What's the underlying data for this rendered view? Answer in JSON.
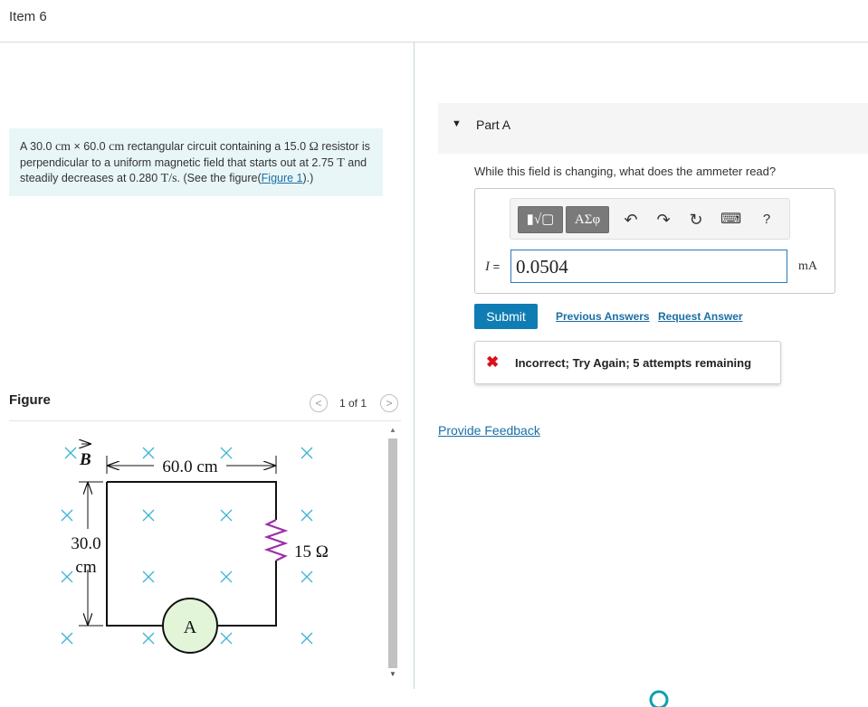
{
  "item_title": "Item 6",
  "problem": {
    "t1": "A 30.0 ",
    "m1": "cm",
    "t2": " × 60.0 ",
    "m2": "cm",
    "t3": " rectangular circuit containing a 15.0 ",
    "m3": "Ω",
    "t4": " resistor is perpendicular to a uniform magnetic field that starts out at 2.75 ",
    "m4": "T",
    "t5": " and steadily decreases at 0.280 ",
    "m5": "T/s",
    "t6": ". (See the figure(",
    "link": "Figure 1",
    "t7": ").)"
  },
  "figure": {
    "label": "Figure",
    "counter": "1 of 1",
    "prev_glyph": "<",
    "next_glyph": ">",
    "labels": {
      "b_field": "B",
      "width": "60.0 cm",
      "height_value": "30.0",
      "height_unit": "cm",
      "resistance": "15 Ω",
      "ammeter": "A"
    }
  },
  "part": {
    "label": "Part A",
    "question": "While this field is changing, what does the ammeter read?"
  },
  "toolbar": {
    "templates_label": "▮√▢",
    "symbols_label": "ΑΣφ",
    "undo_glyph": "↶",
    "redo_glyph": "↷",
    "reset_glyph": "↻",
    "keyboard_glyph": "⌨",
    "help_label": "?"
  },
  "answer": {
    "variable": "I",
    "equals": " =",
    "value": "0.0504",
    "unit": "mA"
  },
  "actions": {
    "submit": "Submit",
    "previous_answers": "Previous Answers",
    "request_answer": "Request Answer"
  },
  "feedback": {
    "icon": "✖",
    "message": "Incorrect; Try Again; 5 attempts remaining"
  },
  "provide_feedback": "Provide Feedback",
  "colors": {
    "accent": "#0f7db3",
    "link": "#1a6fa6",
    "error": "#d9111c",
    "problem_bg": "#e9f6f8",
    "field_marks": "#3bb3d6",
    "ammeter_fill": "#e3f5d8"
  }
}
